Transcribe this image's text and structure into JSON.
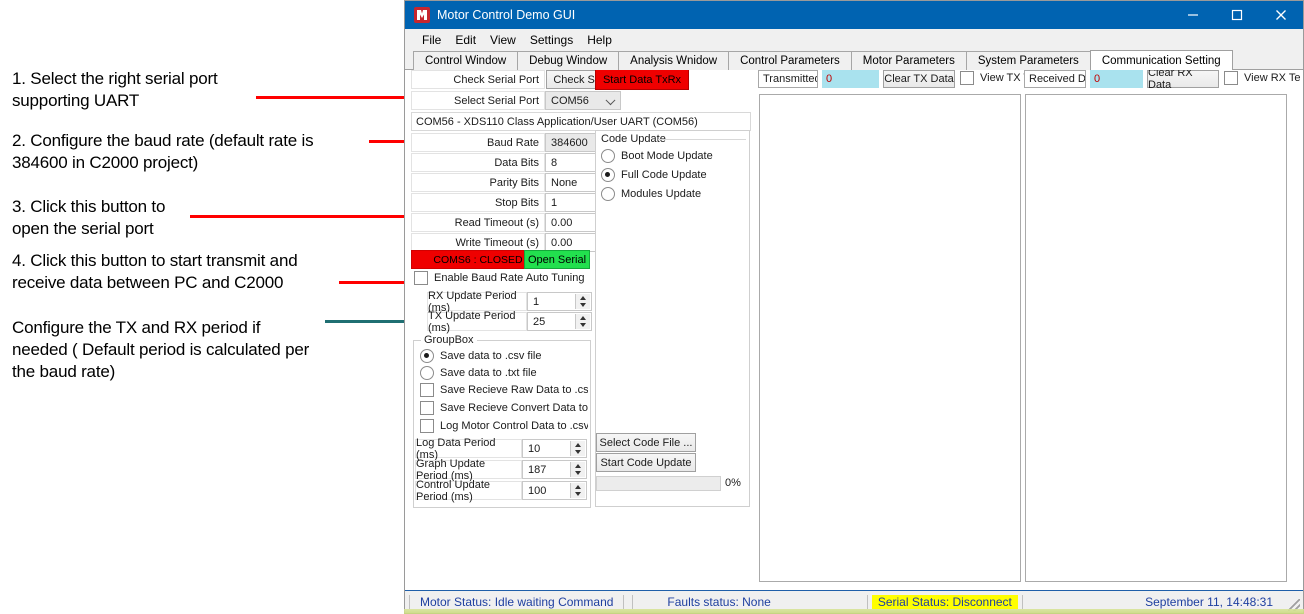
{
  "window": {
    "title": "Motor Control Demo GUI",
    "icon": "app-icon",
    "controls": {
      "minimize": "─",
      "maximize": "☐",
      "close": "✕"
    }
  },
  "menubar": {
    "items": [
      "File",
      "Edit",
      "View",
      "Settings",
      "Help"
    ]
  },
  "tabs": [
    {
      "label": "Control Window",
      "active": false
    },
    {
      "label": "Debug Window",
      "active": false
    },
    {
      "label": "Analysis Wnidow",
      "active": false
    },
    {
      "label": "Control Parameters",
      "active": false
    },
    {
      "label": "Motor Parameters",
      "active": false
    },
    {
      "label": "System Parameters",
      "active": false
    },
    {
      "label": "Communication Setting",
      "active": true
    }
  ],
  "serial": {
    "check_serial_port_label": "Check Serial Port",
    "check_serial_button": "Check Serial",
    "start_data_txrx_button": "Start Data TxRx",
    "select_serial_port_label": "Select Serial Port",
    "select_serial_port_value": "COM56",
    "port_description": "COM56 - XDS110 Class Application/User UART (COM56)",
    "baud_rate_label": "Baud Rate",
    "baud_rate_value": "384600",
    "data_bits_label": "Data Bits",
    "data_bits_value": "8",
    "parity_bits_label": "Parity Bits",
    "parity_bits_value": "None",
    "stop_bits_label": "Stop Bits",
    "stop_bits_value": "1",
    "read_timeout_label": "Read Timeout (s)",
    "read_timeout_value": "0.00",
    "write_timeout_label": "Write Timeout (s)",
    "write_timeout_value": "0.00",
    "port_status": "COMS6 : CLOSED",
    "open_serial_button": "Open Serial",
    "auto_tuning_label": "Enable Baud Rate Auto Tuning",
    "auto_tuning_checked": false,
    "rx_update_label": "RX Update Period (ms)",
    "rx_update_value": "1",
    "tx_update_label": "TX Update Period (ms)",
    "tx_update_value": "25"
  },
  "code_update": {
    "title": "Code Update",
    "options": [
      {
        "label": "Boot Mode Update",
        "selected": false
      },
      {
        "label": "Full Code Update",
        "selected": true
      },
      {
        "label": "Modules Update",
        "selected": false
      }
    ],
    "select_code_file_button": "Select Code File ...",
    "start_code_update_button": "Start Code Update",
    "progress_percent": "0%"
  },
  "groupbox": {
    "title": "GroupBox",
    "radios": [
      {
        "label": "Save data to .csv file",
        "selected": true
      },
      {
        "label": "Save data to .txt file",
        "selected": false
      }
    ],
    "checkboxes": [
      {
        "label": "Save Recieve Raw Data to .csv/.txt Fil",
        "checked": false
      },
      {
        "label": "Save Recieve Convert Data to .csv/.txt",
        "checked": false
      },
      {
        "label": "Log Motor Control Data to .csv/.txt File",
        "checked": false
      }
    ],
    "fields": [
      {
        "label": "Log Data Period (ms)",
        "value": "10"
      },
      {
        "label": "Graph Update Period (ms)",
        "value": "187"
      },
      {
        "label": "Control Update Period (ms)",
        "value": "100"
      }
    ]
  },
  "data_panels": {
    "tx_label": "Transmitted Da",
    "tx_count": "0",
    "tx_clear_button": "Clear TX Data",
    "tx_view_label": "View TX Te",
    "tx_view_checked": false,
    "rx_label": "Received Data",
    "rx_count": "0",
    "rx_clear_button": "Clear RX Data",
    "rx_view_label": "View RX Te",
    "rx_view_checked": false
  },
  "statusbar": {
    "motor_status": "Motor Status: Idle waiting Command",
    "faults_status": "Faults status: None",
    "serial_status": "Serial Status: Disconnect",
    "datetime": "September 11, 14:48:31"
  },
  "annotations": [
    {
      "text": "1. Select the right serial port\nsupporting UART"
    },
    {
      "text": "2. Configure the baud rate (default rate is\n384600 in C2000 project)"
    },
    {
      "text": "3. Click this button to\nopen the serial port"
    },
    {
      "text": "4. Click this button to start transmit and\nreceive data between PC and C2000"
    },
    {
      "text": "Configure the TX and RX period if\nneeded ( Default period is calculated per\nthe baud rate)"
    }
  ],
  "colors": {
    "accent": "#0063b1",
    "annotation_red": "#ff0000",
    "annotation_teal": "#1f6f72",
    "status_closed": "#ef0000",
    "open_serial": "#22e04e",
    "highlight_yellow": "#ffff00",
    "status_text": "#1e3fa0",
    "data_cyan": "#a9e2ee"
  }
}
